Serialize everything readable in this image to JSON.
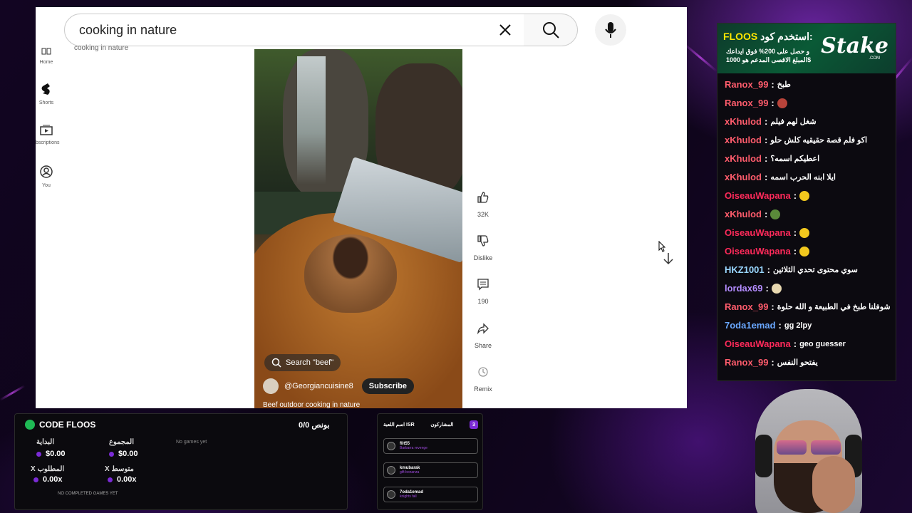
{
  "search": {
    "query": "cooking in nature"
  },
  "nav": {
    "home": "Home",
    "shorts": "Shorts",
    "subscriptions": "bscriptions",
    "you": "You"
  },
  "breadcrumb": "cooking in nature",
  "video": {
    "search_chip": "Search \"beef\"",
    "channel": "@Georgiancuisine8",
    "subscribe": "Subscribe",
    "caption": "Beef outdoor cooking in nature"
  },
  "actions": {
    "likes": "32K",
    "dislike": "Dislike",
    "comments": "190",
    "share": "Share",
    "remix": "Remix"
  },
  "chat": {
    "banner": {
      "code_label": "استخدم كود:",
      "code": "FLOOS",
      "line2": "و حصل على 200% فوق ايداعك",
      "line3": "المبلغ الاقصى المدعم هو 1000$",
      "brand": "Stake",
      "brand_sub": ".COM"
    },
    "messages": [
      {
        "user": "Ranox_99",
        "color": "#ff5c6c",
        "text": "طبخ"
      },
      {
        "user": "Ranox_99",
        "color": "#ff5c6c",
        "text": "",
        "emoji": "#b8433a"
      },
      {
        "user": "xKhulod",
        "color": "#ff5c6c",
        "text": "شغل لهم فيلم"
      },
      {
        "user": "xKhulod",
        "color": "#ff5c6c",
        "text": "اكو فلم قصة حقيقيه كلش حلو"
      },
      {
        "user": "xKhulod",
        "color": "#ff5c6c",
        "text": "اعطيكم اسمه؟"
      },
      {
        "user": "xKhulod",
        "color": "#ff5c6c",
        "text": "ايلا ابنه الحرب اسمه"
      },
      {
        "user": "OiseauWapana",
        "color": "#ff2a5a",
        "text": "",
        "emoji": "#f2c81e"
      },
      {
        "user": "xKhulod",
        "color": "#ff5c6c",
        "text": "",
        "emoji": "#5a8a3a"
      },
      {
        "user": "OiseauWapana",
        "color": "#ff2a5a",
        "text": "",
        "emoji": "#f2c81e"
      },
      {
        "user": "OiseauWapana",
        "color": "#ff2a5a",
        "text": "",
        "emoji": "#f2c81e"
      },
      {
        "user": "HKZ1001",
        "color": "#9ad7ff",
        "text": "سوي محتوى تحدي الثلاثين"
      },
      {
        "user": "lordax69",
        "color": "#b48cff",
        "text": "",
        "emoji": "#e8d8b0"
      },
      {
        "user": "Ranox_99",
        "color": "#ff5c6c",
        "text": "شوفلنا طبخ في الطبيعة و الله حلوة"
      },
      {
        "user": "7oda1emad",
        "color": "#6aa8ff",
        "text": "gg 2lpy"
      },
      {
        "user": "OiseauWapana",
        "color": "#ff2a5a",
        "text": "geo guesser"
      },
      {
        "user": "Ranox_99",
        "color": "#ff5c6c",
        "text": "يفتحو النفس"
      }
    ]
  },
  "code_panel": {
    "title": "CODE FLOOS",
    "bonus": "0/0 بونص",
    "start_label": "البداية",
    "start_value": "$0.00",
    "total_label": "المجموع",
    "total_value": "$0.00",
    "required_label": "X المطلوب",
    "required_value": "0.00x",
    "avg_label": "X متوسط",
    "avg_value": "0.00x",
    "no_games": "No games yet",
    "no_completed": "NO COMPLETED GAMES YET"
  },
  "players_panel": {
    "title": "اسم اللعبة ISR",
    "participants": "المشاركون",
    "count": "3",
    "players": [
      {
        "name": "flit55",
        "game": "Barbarra revenge"
      },
      {
        "name": "kmubarak",
        "game": "gift bonanza"
      },
      {
        "name": "7oda1emad",
        "game": "knights fall"
      }
    ]
  }
}
